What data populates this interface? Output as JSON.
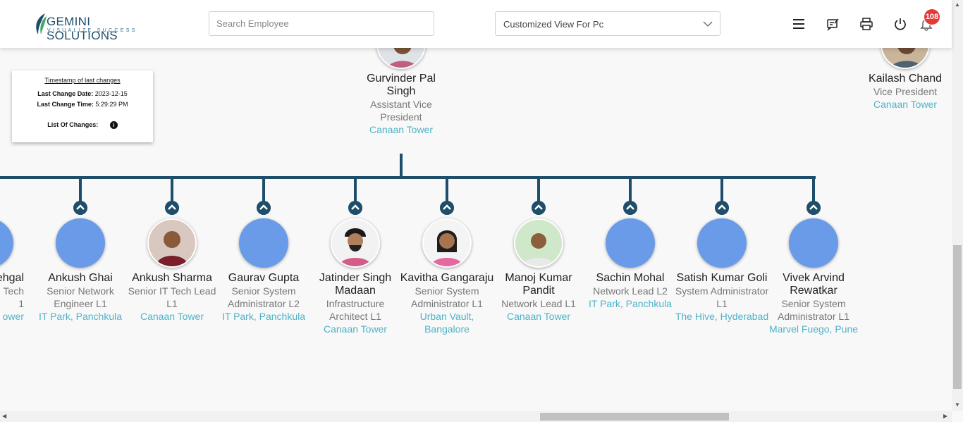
{
  "header": {
    "logo_name": "GEMINI SOLUTIONS",
    "logo_tagline": "VISUALIZE SUCCESS",
    "search_placeholder": "Search Employee",
    "view_selected": "Customized View For Pc",
    "notification_count": "108",
    "icons": [
      "menu-icon",
      "feedback-icon",
      "print-icon",
      "power-icon",
      "bell-icon"
    ]
  },
  "timestamp": {
    "title": "Timestamp of last changes",
    "date_label": "Last Change Date:",
    "date_value": "2023-12-15",
    "time_label": "Last Change Time:",
    "time_value": "5:29:29 PM",
    "changes_label": "List Of Changes:"
  },
  "manager": {
    "name": "Gurvinder Pal Singh",
    "role": "Assistant Vice President",
    "location": "Canaan Tower"
  },
  "peer": {
    "name": "Kailash Chand",
    "role": "Vice President",
    "location": "Canaan Tower"
  },
  "reports": [
    {
      "name": "ehgal",
      "role": "Tech",
      "role2": "1",
      "location": "ower",
      "photo": false
    },
    {
      "name": "Ankush Ghai",
      "role": "Senior Network Engineer L1",
      "location": "IT Park, Panchkula",
      "photo": false
    },
    {
      "name": "Ankush Sharma",
      "role": "Senior IT Tech Lead L1",
      "location": "Canaan Tower",
      "photo": true
    },
    {
      "name": "Gaurav Gupta",
      "role": "Senior System Administrator L2",
      "location": "IT Park, Panchkula",
      "photo": false
    },
    {
      "name": "Jatinder Singh Madaan",
      "role": "Infrastructure Architect L1",
      "location": "Canaan Tower",
      "photo": true
    },
    {
      "name": "Kavitha Gangaraju",
      "role": "Senior System Administrator L1",
      "location": "Urban Vault, Bangalore",
      "photo": true
    },
    {
      "name": "Manoj Kumar Pandit",
      "role": "Network Lead L1",
      "location": "Canaan Tower",
      "photo": true
    },
    {
      "name": "Sachin Mohal",
      "role": "Network Lead L2",
      "location": "IT Park, Panchkula",
      "photo": false
    },
    {
      "name": "Satish Kumar Goli",
      "role": "System Administrator L1",
      "location": "The Hive, Hyderabad",
      "photo": false
    },
    {
      "name": "Vivek Arvind Rewatkar",
      "role": "Senior System Administrator L1",
      "location": "Marvel Fuego, Pune",
      "photo": false
    }
  ],
  "colors": {
    "line": "#1f4e6b",
    "avatar": "#6a9be8",
    "location": "#4fb3c7",
    "badge": "#e53935"
  }
}
